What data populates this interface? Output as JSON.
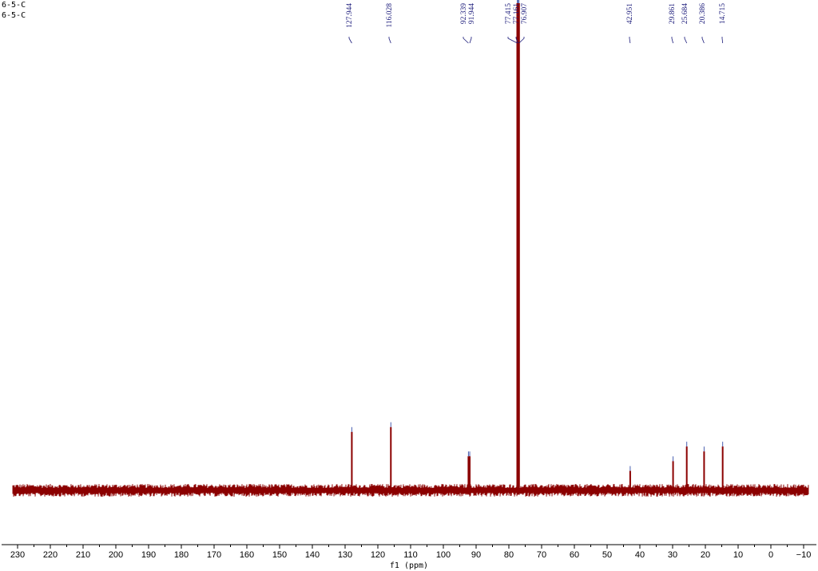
{
  "window": {
    "title_lines": [
      "6-5-C",
      "6-5-C"
    ]
  },
  "colors": {
    "spectrum": "#8b0000",
    "peak_labels": "#1a1a7a",
    "axis": "#000000",
    "background": "#ffffff"
  },
  "chart_data": {
    "type": "line",
    "title": "",
    "xlabel": "f1 (ppm)",
    "ylabel": "",
    "xlim": [
      232,
      -12
    ],
    "x_reversed": true,
    "grid": false,
    "x_ticks": [
      230,
      220,
      210,
      200,
      190,
      180,
      170,
      160,
      150,
      140,
      130,
      120,
      110,
      100,
      90,
      80,
      70,
      60,
      50,
      40,
      30,
      20,
      10,
      0,
      -10
    ],
    "peak_labels": [
      "127.944",
      "116.028",
      "92.339",
      "91.944",
      "77.415",
      "77.161",
      "76.907",
      "42.951",
      "29.861",
      "25.684",
      "20.386",
      "14.715"
    ],
    "series": [
      {
        "peaks": [
          {
            "shift": 127.944,
            "intensity": 0.12
          },
          {
            "shift": 116.028,
            "intensity": 0.13
          },
          {
            "shift": 92.339,
            "intensity": 0.07
          },
          {
            "shift": 91.944,
            "intensity": 0.07
          },
          {
            "shift": 77.415,
            "intensity": 1.0
          },
          {
            "shift": 77.161,
            "intensity": 1.0
          },
          {
            "shift": 76.907,
            "intensity": 1.0
          },
          {
            "shift": 42.951,
            "intensity": 0.04
          },
          {
            "shift": 29.861,
            "intensity": 0.06
          },
          {
            "shift": 25.684,
            "intensity": 0.09
          },
          {
            "shift": 20.386,
            "intensity": 0.08
          },
          {
            "shift": 14.715,
            "intensity": 0.09
          }
        ]
      }
    ]
  }
}
